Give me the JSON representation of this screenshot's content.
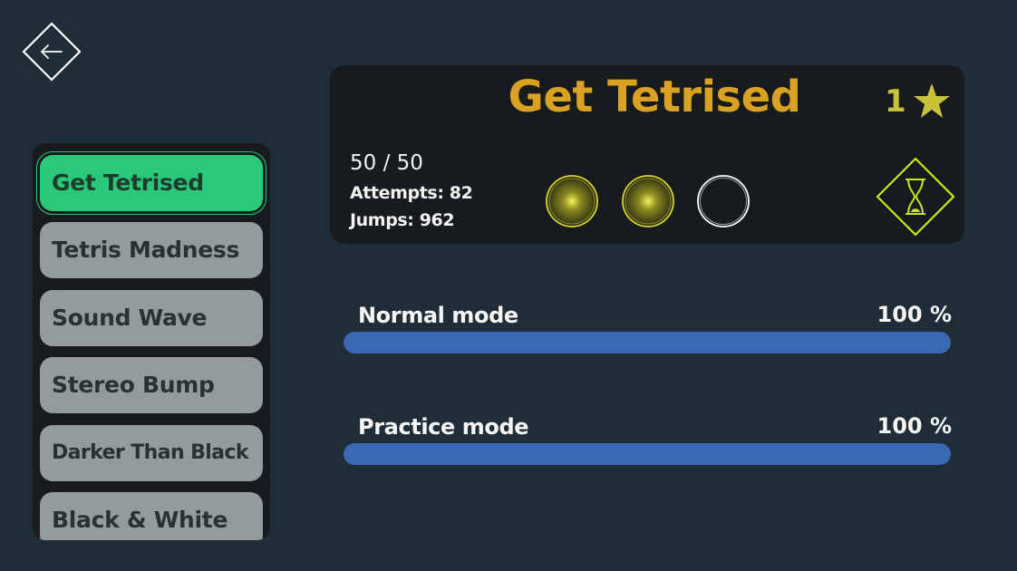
{
  "colors": {
    "background": "#1e2d37",
    "panel": "#171b1e",
    "selected_item": "#2ac97a",
    "item": "#949b9d",
    "title": "#d9a222",
    "star": "#c7c239",
    "coin_collected": "#e8e63a",
    "coin_empty": "#ffffff",
    "progress_bar": "#3a68b4",
    "hourglass": "#c9e81c"
  },
  "back_button": {
    "icon": "arrow-left-icon"
  },
  "levels": [
    {
      "name": "Get Tetrised",
      "selected": true
    },
    {
      "name": "Tetris Madness",
      "selected": false
    },
    {
      "name": "Sound Wave",
      "selected": false
    },
    {
      "name": "Stereo Bump",
      "selected": false
    },
    {
      "name": "Darker Than Black",
      "selected": false
    },
    {
      "name": "Black & White",
      "selected": false
    }
  ],
  "info": {
    "title": "Get Tetrised",
    "stars": "1",
    "star_icon": "star-icon",
    "progress": "50 / 50",
    "attempts": "Attempts: 82",
    "jumps": "Jumps: 962",
    "coins": [
      {
        "collected": true
      },
      {
        "collected": true
      },
      {
        "collected": false
      }
    ],
    "hourglass_icon": "hourglass-icon"
  },
  "modes": [
    {
      "label": "Normal mode",
      "percent_text": "100 %",
      "progress": 1.0
    },
    {
      "label": "Practice mode",
      "percent_text": "100 %",
      "progress": 1.0
    }
  ]
}
